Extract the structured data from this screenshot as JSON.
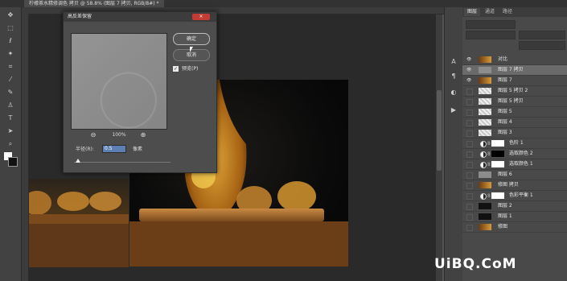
{
  "document_tab": "柠檬茶水精修调色 拷贝 @ 58.8% (图层 7 拷贝, RGB/8#) *",
  "panel_tabs": [
    "图层",
    "通道",
    "路径"
  ],
  "layers": [
    {
      "name": "对比",
      "type": "photo",
      "visible": true,
      "selected": false
    },
    {
      "name": "图层 7 拷贝",
      "type": "gray",
      "visible": true,
      "selected": true
    },
    {
      "name": "图层 7",
      "type": "photo",
      "visible": true,
      "selected": false
    },
    {
      "name": "图层 5 拷贝 2",
      "type": "checker",
      "visible": false,
      "selected": false
    },
    {
      "name": "图层 5 拷贝",
      "type": "checker",
      "visible": false,
      "selected": false
    },
    {
      "name": "图层 5",
      "type": "checker",
      "visible": false,
      "selected": false
    },
    {
      "name": "图层 4",
      "type": "checker",
      "visible": false,
      "selected": false
    },
    {
      "name": "图层 3",
      "type": "checker",
      "visible": false,
      "selected": false
    },
    {
      "name": "色阶 1",
      "type": "adjust-white",
      "visible": false,
      "selected": false
    },
    {
      "name": "选取颜色 2",
      "type": "adjust-dark",
      "visible": false,
      "selected": false
    },
    {
      "name": "选取颜色 1",
      "type": "adjust-white",
      "visible": false,
      "selected": false
    },
    {
      "name": "图层 6",
      "type": "gray",
      "visible": false,
      "selected": false
    },
    {
      "name": "修图 拷贝",
      "type": "photo",
      "visible": false,
      "selected": false
    },
    {
      "name": "色彩平衡 1",
      "type": "adjust-white",
      "visible": false,
      "selected": false
    },
    {
      "name": "图层 2",
      "type": "dark",
      "visible": false,
      "selected": false
    },
    {
      "name": "图层 1",
      "type": "dark",
      "visible": false,
      "selected": false
    },
    {
      "name": "修图",
      "type": "photo",
      "visible": false,
      "selected": false
    }
  ],
  "dialog": {
    "title": "高反差保留",
    "ok_label": "确定",
    "cancel_label": "取消",
    "preview_label": "预览(P)",
    "preview_checked": true,
    "zoom": "100%",
    "radius_label": "半径(R):",
    "radius_value": "0.5",
    "radius_unit": "像素",
    "close_glyph": "×"
  },
  "watermark": "UiBQ.CoM",
  "colors": {
    "accent_input": "#5e7fb3",
    "close_button": "#c23b34",
    "selected_layer": "#6a6a6a"
  },
  "icons": [
    "move-icon",
    "marquee-icon",
    "lasso-icon",
    "magic-wand-icon",
    "crop-icon",
    "eyedropper-icon",
    "brush-icon",
    "stamp-icon",
    "eraser-icon",
    "gradient-icon",
    "blur-icon",
    "dodge-icon",
    "pen-icon",
    "text-icon",
    "path-select-icon",
    "shape-icon",
    "hand-icon",
    "zoom-icon"
  ]
}
